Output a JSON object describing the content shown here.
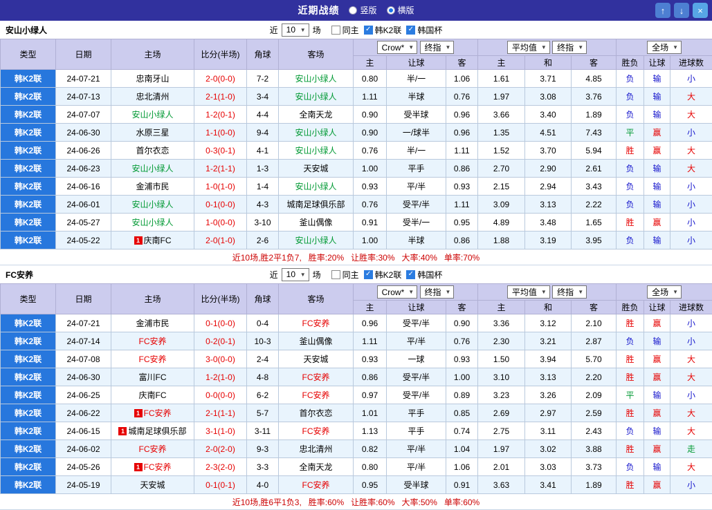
{
  "titlebar": {
    "title": "近期战绩",
    "radios": [
      {
        "label": "竖版",
        "checked": false,
        "name": "vertical-layout-radio"
      },
      {
        "label": "横版",
        "checked": true,
        "name": "horizontal-layout-radio"
      }
    ],
    "buttons": {
      "up": "↑",
      "down": "↓",
      "close": "×"
    }
  },
  "controls": {
    "near": "近",
    "count": "10",
    "unit": "场",
    "checkboxes": [
      {
        "label": "同主",
        "checked": false,
        "name": "same-home-checkbox"
      },
      {
        "label": "韩K2联",
        "checked": true,
        "name": "k2-league-checkbox"
      },
      {
        "label": "韩国杯",
        "checked": true,
        "name": "korea-cup-checkbox"
      }
    ]
  },
  "table_header": {
    "type": "类型",
    "date": "日期",
    "home": "主场",
    "score": "比分(半场)",
    "corner": "角球",
    "away": "客场",
    "bookmaker": "Crow*",
    "final_index": "终指",
    "average": "平均值",
    "full_match": "全场",
    "o_home": "主",
    "o_hcp": "让球",
    "o_away": "客",
    "e_home": "主",
    "e_draw": "和",
    "e_away": "客",
    "r_wdl": "胜负",
    "r_hcp": "让球",
    "r_goal": "进球数"
  },
  "badge_label": "1",
  "colors": {
    "titlebar_bg": "#31319e",
    "header_bg": "#ccccee",
    "league_bg": "#2777dd",
    "row_alt_bg": "#e9f4fd",
    "red": "#e60000",
    "blue": "#1414cc",
    "green": "#009933",
    "summary_red": "#cc0000"
  },
  "sections": [
    {
      "team": "安山小绿人",
      "rows": [
        {
          "league": "韩K2联",
          "date": "24-07-21",
          "home": "忠南牙山",
          "home_color": "",
          "home_badge": false,
          "score": "2-0(0-0)",
          "corner": "7-2",
          "away": "安山小绿人",
          "away_color": "green",
          "away_badge": false,
          "odds": [
            "0.80",
            "半/一",
            "1.06"
          ],
          "euro": [
            "1.61",
            "3.71",
            "4.85"
          ],
          "results": [
            [
              "负",
              "blue"
            ],
            [
              "输",
              "blue"
            ],
            [
              "小",
              "blue"
            ]
          ]
        },
        {
          "league": "韩K2联",
          "date": "24-07-13",
          "home": "忠北清州",
          "home_color": "",
          "home_badge": false,
          "score": "2-1(1-0)",
          "corner": "3-4",
          "away": "安山小绿人",
          "away_color": "green",
          "away_badge": false,
          "odds": [
            "1.11",
            "半球",
            "0.76"
          ],
          "euro": [
            "1.97",
            "3.08",
            "3.76"
          ],
          "results": [
            [
              "负",
              "blue"
            ],
            [
              "输",
              "blue"
            ],
            [
              "大",
              "red"
            ]
          ]
        },
        {
          "league": "韩K2联",
          "date": "24-07-07",
          "home": "安山小绿人",
          "home_color": "green",
          "home_badge": false,
          "score": "1-2(0-1)",
          "corner": "4-4",
          "away": "全南天龙",
          "away_color": "",
          "away_badge": false,
          "odds": [
            "0.90",
            "受半球",
            "0.96"
          ],
          "euro": [
            "3.66",
            "3.40",
            "1.89"
          ],
          "results": [
            [
              "负",
              "blue"
            ],
            [
              "输",
              "blue"
            ],
            [
              "大",
              "red"
            ]
          ]
        },
        {
          "league": "韩K2联",
          "date": "24-06-30",
          "home": "水原三星",
          "home_color": "",
          "home_badge": false,
          "score": "1-1(0-0)",
          "corner": "9-4",
          "away": "安山小绿人",
          "away_color": "green",
          "away_badge": false,
          "odds": [
            "0.90",
            "一/球半",
            "0.96"
          ],
          "euro": [
            "1.35",
            "4.51",
            "7.43"
          ],
          "results": [
            [
              "平",
              "green"
            ],
            [
              "赢",
              "red"
            ],
            [
              "小",
              "blue"
            ]
          ]
        },
        {
          "league": "韩K2联",
          "date": "24-06-26",
          "home": "首尔衣恋",
          "home_color": "",
          "home_badge": false,
          "score": "0-3(0-1)",
          "corner": "4-1",
          "away": "安山小绿人",
          "away_color": "green",
          "away_badge": false,
          "odds": [
            "0.76",
            "半/一",
            "1.11"
          ],
          "euro": [
            "1.52",
            "3.70",
            "5.94"
          ],
          "results": [
            [
              "胜",
              "red"
            ],
            [
              "赢",
              "red"
            ],
            [
              "大",
              "red"
            ]
          ]
        },
        {
          "league": "韩K2联",
          "date": "24-06-23",
          "home": "安山小绿人",
          "home_color": "green",
          "home_badge": false,
          "score": "1-2(1-1)",
          "corner": "1-3",
          "away": "天安城",
          "away_color": "",
          "away_badge": false,
          "odds": [
            "1.00",
            "平手",
            "0.86"
          ],
          "euro": [
            "2.70",
            "2.90",
            "2.61"
          ],
          "results": [
            [
              "负",
              "blue"
            ],
            [
              "输",
              "blue"
            ],
            [
              "大",
              "red"
            ]
          ]
        },
        {
          "league": "韩K2联",
          "date": "24-06-16",
          "home": "金浦市民",
          "home_color": "",
          "home_badge": false,
          "score": "1-0(1-0)",
          "corner": "1-4",
          "away": "安山小绿人",
          "away_color": "green",
          "away_badge": false,
          "odds": [
            "0.93",
            "平/半",
            "0.93"
          ],
          "euro": [
            "2.15",
            "2.94",
            "3.43"
          ],
          "results": [
            [
              "负",
              "blue"
            ],
            [
              "输",
              "blue"
            ],
            [
              "小",
              "blue"
            ]
          ]
        },
        {
          "league": "韩K2联",
          "date": "24-06-01",
          "home": "安山小绿人",
          "home_color": "green",
          "home_badge": false,
          "score": "0-1(0-0)",
          "corner": "4-3",
          "away": "城南足球俱乐部",
          "away_color": "",
          "away_badge": false,
          "odds": [
            "0.76",
            "受平/半",
            "1.11"
          ],
          "euro": [
            "3.09",
            "3.13",
            "2.22"
          ],
          "results": [
            [
              "负",
              "blue"
            ],
            [
              "输",
              "blue"
            ],
            [
              "小",
              "blue"
            ]
          ]
        },
        {
          "league": "韩K2联",
          "date": "24-05-27",
          "home": "安山小绿人",
          "home_color": "green",
          "home_badge": false,
          "score": "1-0(0-0)",
          "corner": "3-10",
          "away": "釜山偶像",
          "away_color": "",
          "away_badge": false,
          "odds": [
            "0.91",
            "受半/一",
            "0.95"
          ],
          "euro": [
            "4.89",
            "3.48",
            "1.65"
          ],
          "results": [
            [
              "胜",
              "red"
            ],
            [
              "赢",
              "red"
            ],
            [
              "小",
              "blue"
            ]
          ]
        },
        {
          "league": "韩K2联",
          "date": "24-05-22",
          "home": "庆南FC",
          "home_color": "",
          "home_badge": true,
          "score": "2-0(1-0)",
          "corner": "2-6",
          "away": "安山小绿人",
          "away_color": "green",
          "away_badge": false,
          "odds": [
            "1.00",
            "半球",
            "0.86"
          ],
          "euro": [
            "1.88",
            "3.19",
            "3.95"
          ],
          "results": [
            [
              "负",
              "blue"
            ],
            [
              "输",
              "blue"
            ],
            [
              "小",
              "blue"
            ]
          ]
        }
      ],
      "summary": {
        "record": "近10场,胜2平1负7,",
        "rates": [
          "胜率:20%",
          "让胜率:30%",
          "大率:40%",
          "单率:70%"
        ]
      }
    },
    {
      "team": "FC安养",
      "rows": [
        {
          "league": "韩K2联",
          "date": "24-07-21",
          "home": "金浦市民",
          "home_color": "",
          "home_badge": false,
          "score": "0-1(0-0)",
          "corner": "0-4",
          "away": "FC安养",
          "away_color": "red",
          "away_badge": false,
          "odds": [
            "0.96",
            "受平/半",
            "0.90"
          ],
          "euro": [
            "3.36",
            "3.12",
            "2.10"
          ],
          "results": [
            [
              "胜",
              "red"
            ],
            [
              "赢",
              "red"
            ],
            [
              "小",
              "blue"
            ]
          ]
        },
        {
          "league": "韩K2联",
          "date": "24-07-14",
          "home": "FC安养",
          "home_color": "red",
          "home_badge": false,
          "score": "0-2(0-1)",
          "corner": "10-3",
          "away": "釜山偶像",
          "away_color": "",
          "away_badge": false,
          "odds": [
            "1.11",
            "平/半",
            "0.76"
          ],
          "euro": [
            "2.30",
            "3.21",
            "2.87"
          ],
          "results": [
            [
              "负",
              "blue"
            ],
            [
              "输",
              "blue"
            ],
            [
              "小",
              "blue"
            ]
          ]
        },
        {
          "league": "韩K2联",
          "date": "24-07-08",
          "home": "FC安养",
          "home_color": "red",
          "home_badge": false,
          "score": "3-0(0-0)",
          "corner": "2-4",
          "away": "天安城",
          "away_color": "",
          "away_badge": false,
          "odds": [
            "0.93",
            "一球",
            "0.93"
          ],
          "euro": [
            "1.50",
            "3.94",
            "5.70"
          ],
          "results": [
            [
              "胜",
              "red"
            ],
            [
              "赢",
              "red"
            ],
            [
              "大",
              "red"
            ]
          ]
        },
        {
          "league": "韩K2联",
          "date": "24-06-30",
          "home": "富川FC",
          "home_color": "",
          "home_badge": false,
          "score": "1-2(1-0)",
          "corner": "4-8",
          "away": "FC安养",
          "away_color": "red",
          "away_badge": false,
          "odds": [
            "0.86",
            "受平/半",
            "1.00"
          ],
          "euro": [
            "3.10",
            "3.13",
            "2.20"
          ],
          "results": [
            [
              "胜",
              "red"
            ],
            [
              "赢",
              "red"
            ],
            [
              "大",
              "red"
            ]
          ]
        },
        {
          "league": "韩K2联",
          "date": "24-06-25",
          "home": "庆南FC",
          "home_color": "",
          "home_badge": false,
          "score": "0-0(0-0)",
          "corner": "6-2",
          "away": "FC安养",
          "away_color": "red",
          "away_badge": false,
          "odds": [
            "0.97",
            "受平/半",
            "0.89"
          ],
          "euro": [
            "3.23",
            "3.26",
            "2.09"
          ],
          "results": [
            [
              "平",
              "green"
            ],
            [
              "输",
              "blue"
            ],
            [
              "小",
              "blue"
            ]
          ]
        },
        {
          "league": "韩K2联",
          "date": "24-06-22",
          "home": "FC安养",
          "home_color": "red",
          "home_badge": true,
          "score": "2-1(1-1)",
          "corner": "5-7",
          "away": "首尔衣恋",
          "away_color": "",
          "away_badge": false,
          "odds": [
            "1.01",
            "平手",
            "0.85"
          ],
          "euro": [
            "2.69",
            "2.97",
            "2.59"
          ],
          "results": [
            [
              "胜",
              "red"
            ],
            [
              "赢",
              "red"
            ],
            [
              "大",
              "red"
            ]
          ]
        },
        {
          "league": "韩K2联",
          "date": "24-06-15",
          "home": "城南足球俱乐部",
          "home_color": "",
          "home_badge": true,
          "score": "3-1(1-0)",
          "corner": "3-11",
          "away": "FC安养",
          "away_color": "red",
          "away_badge": false,
          "odds": [
            "1.13",
            "平手",
            "0.74"
          ],
          "euro": [
            "2.75",
            "3.11",
            "2.43"
          ],
          "results": [
            [
              "负",
              "blue"
            ],
            [
              "输",
              "blue"
            ],
            [
              "大",
              "red"
            ]
          ]
        },
        {
          "league": "韩K2联",
          "date": "24-06-02",
          "home": "FC安养",
          "home_color": "red",
          "home_badge": false,
          "score": "2-0(2-0)",
          "corner": "9-3",
          "away": "忠北清州",
          "away_color": "",
          "away_badge": false,
          "odds": [
            "0.82",
            "平/半",
            "1.04"
          ],
          "euro": [
            "1.97",
            "3.02",
            "3.88"
          ],
          "results": [
            [
              "胜",
              "red"
            ],
            [
              "赢",
              "red"
            ],
            [
              "走",
              "green"
            ]
          ]
        },
        {
          "league": "韩K2联",
          "date": "24-05-26",
          "home": "FC安养",
          "home_color": "red",
          "home_badge": true,
          "score": "2-3(2-0)",
          "corner": "3-3",
          "away": "全南天龙",
          "away_color": "",
          "away_badge": false,
          "odds": [
            "0.80",
            "平/半",
            "1.06"
          ],
          "euro": [
            "2.01",
            "3.03",
            "3.73"
          ],
          "results": [
            [
              "负",
              "blue"
            ],
            [
              "输",
              "blue"
            ],
            [
              "大",
              "red"
            ]
          ]
        },
        {
          "league": "韩K2联",
          "date": "24-05-19",
          "home": "天安城",
          "home_color": "",
          "home_badge": false,
          "score": "0-1(0-1)",
          "corner": "4-0",
          "away": "FC安养",
          "away_color": "red",
          "away_badge": false,
          "odds": [
            "0.95",
            "受半球",
            "0.91"
          ],
          "euro": [
            "3.63",
            "3.41",
            "1.89"
          ],
          "results": [
            [
              "胜",
              "red"
            ],
            [
              "赢",
              "red"
            ],
            [
              "小",
              "blue"
            ]
          ]
        }
      ],
      "summary": {
        "record": "近10场,胜6平1负3,",
        "rates": [
          "胜率:60%",
          "让胜率:60%",
          "大率:50%",
          "单率:60%"
        ]
      }
    }
  ]
}
